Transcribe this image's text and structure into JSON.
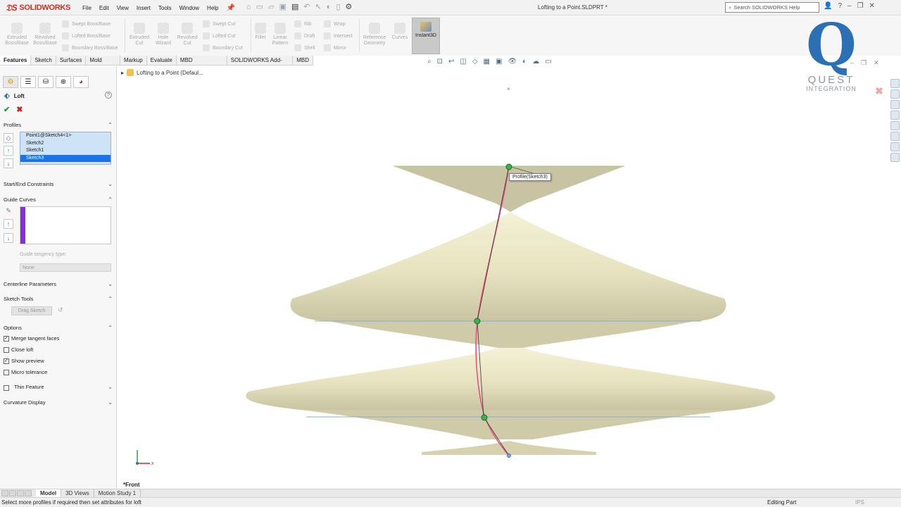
{
  "app": {
    "brand": "SOLIDWORKS",
    "document_title": "Lofting to a Point.SLDPRT *",
    "menus": [
      "File",
      "Edit",
      "View",
      "Insert",
      "Tools",
      "Window",
      "Help"
    ],
    "search_placeholder": "Search SOLIDWORKS Help"
  },
  "commands": {
    "extruded_boss": "Extruded Boss/Base",
    "revolved_boss": "Revolved Boss/Base",
    "swept_boss": "Swept Boss/Base",
    "lofted_boss": "Lofted Boss/Base",
    "boundary_boss": "Boundary Boss/Base",
    "extruded_cut": "Extruded Cut",
    "hole_wizard": "Hole Wizard",
    "revolved_cut": "Revolved Cut",
    "swept_cut": "Swept Cut",
    "lofted_cut": "Lofted Cut",
    "boundary_cut": "Boundary Cut",
    "fillet": "Fillet",
    "linear_pattern": "Linear Pattern",
    "rib": "Rib",
    "draft": "Draft",
    "shell": "Shell",
    "wrap": "Wrap",
    "intersect": "Intersect",
    "mirror": "Mirror",
    "reference_geometry": "Reference Geometry",
    "curves": "Curves",
    "instant3d": "Instant3D"
  },
  "tabs": [
    "Features",
    "Sketch",
    "Surfaces",
    "Mold Tools",
    "Markup",
    "Evaluate",
    "MBD Dimensions",
    "SOLIDWORKS Add-Ins",
    "MBD"
  ],
  "feature_tree": {
    "root": "Lofting to a Point  (Defaul..."
  },
  "property_manager": {
    "title": "Loft",
    "help": "?",
    "ok": "✔",
    "cancel": "✖",
    "profiles_label": "Profiles",
    "profiles": [
      "Point1@Sketch4<1>",
      "Sketch2",
      "Sketch1",
      "Sketch3"
    ],
    "start_end_label": "Start/End Constraints",
    "guide_curves_label": "Guide Curves",
    "guide_tangency_label": "Guide tangency type:",
    "guide_tangency_value": "None",
    "centerline_label": "Centerline Parameters",
    "sketch_tools_label": "Sketch Tools",
    "drag_sketch": "Drag Sketch",
    "options_label": "Options",
    "options": [
      {
        "label": "Merge tangent faces",
        "checked": true
      },
      {
        "label": "Close loft",
        "checked": false
      },
      {
        "label": "Show preview",
        "checked": true
      },
      {
        "label": "Micro tolerance",
        "checked": false
      }
    ],
    "thin_feature_label": "Thin Feature",
    "curvature_label": "Curvature Display"
  },
  "viewport": {
    "tooltip": "Profile(Sketch3)",
    "view_name": "*Front",
    "model_color": "#e7e3c0",
    "guide_color": "#e75480"
  },
  "logo": {
    "letter": "Q",
    "line1": "QUEST",
    "line2": "INTEGRATION"
  },
  "bottom_tabs": [
    "Model",
    "3D Views",
    "Motion Study 1"
  ],
  "status": {
    "message": "Select more profiles if required then set attributes for loft",
    "mode": "Editing Part",
    "units": "IPS"
  }
}
